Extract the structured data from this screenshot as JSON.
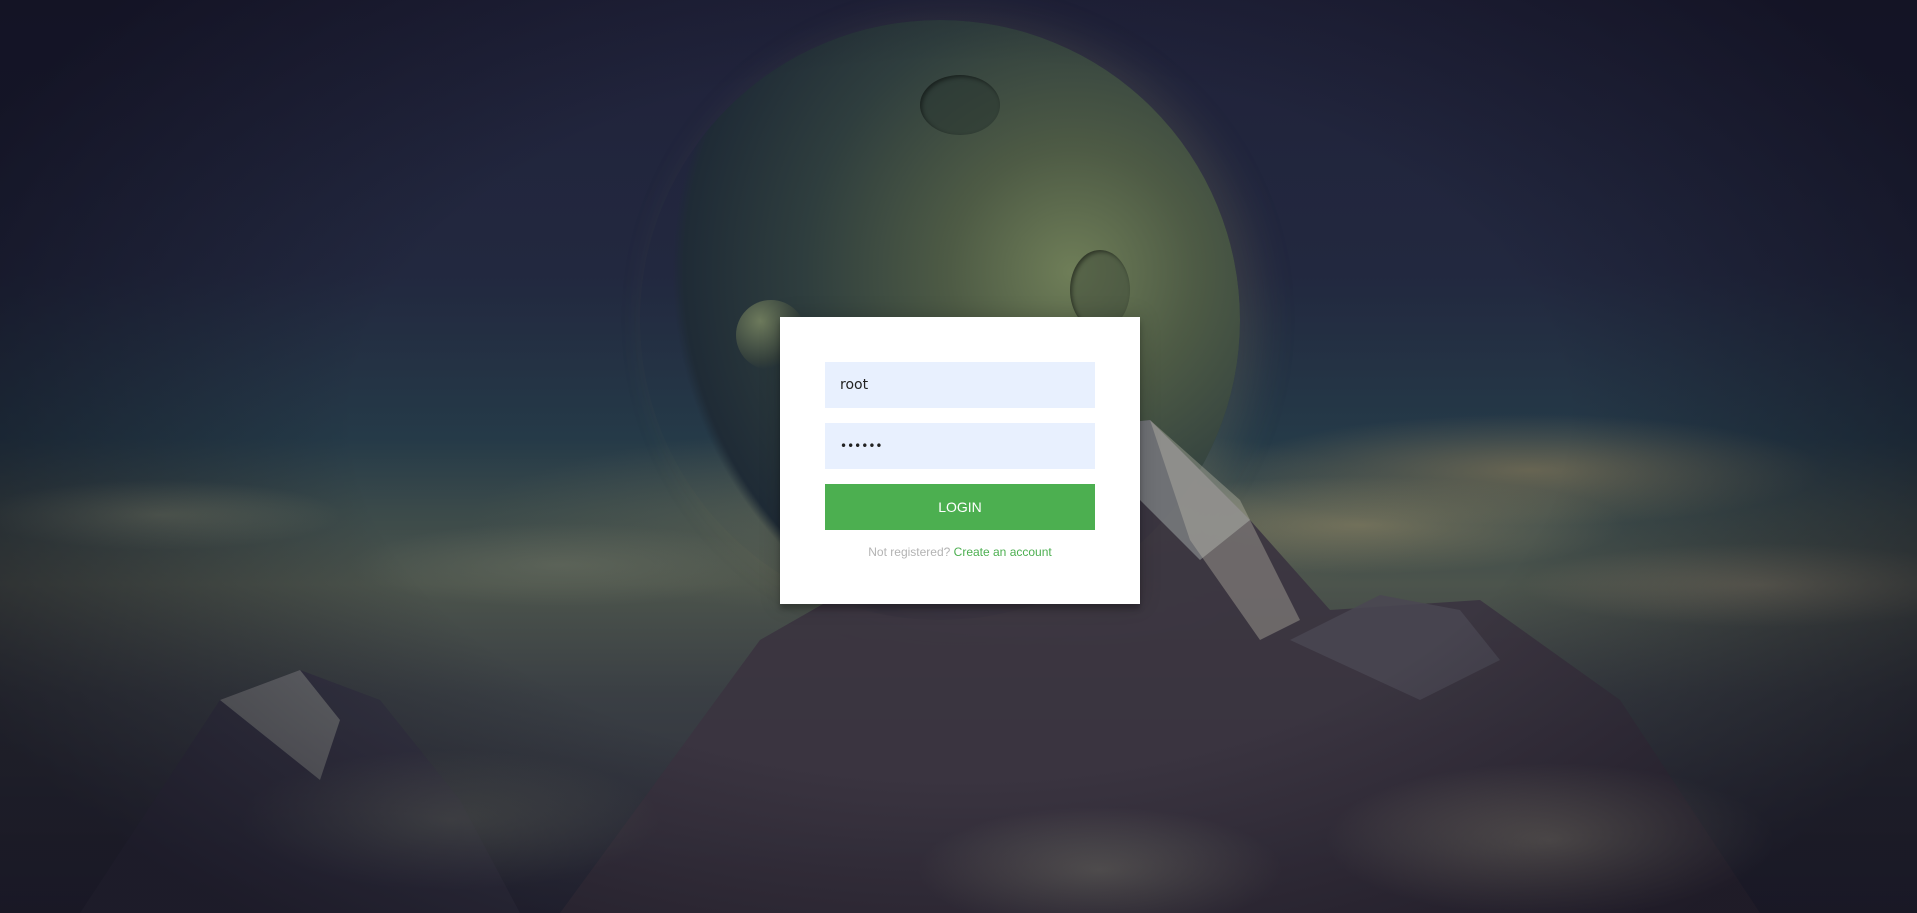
{
  "login_form": {
    "username_value": "root",
    "password_value": "••••••",
    "login_button_label": "LOGIN",
    "register_prompt": "Not registered?",
    "create_account_link": "Create an account"
  },
  "colors": {
    "accent": "#4caf50",
    "input_background": "#e8f0fe",
    "card_background": "#ffffff",
    "muted_text": "#b3b3b3"
  },
  "icons": {
    "background": "space-mountain-background"
  }
}
